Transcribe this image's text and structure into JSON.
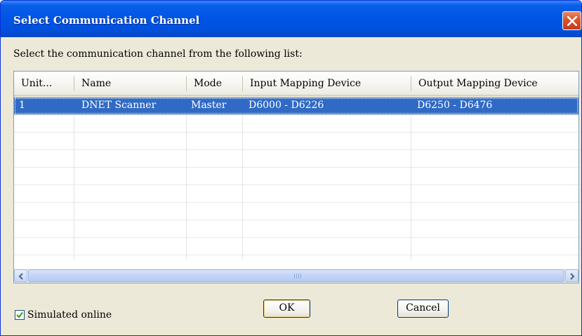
{
  "window": {
    "title": "Select Communication Channel",
    "close_icon": "close-x-icon"
  },
  "prompt": "Select the communication channel from the following list:",
  "table": {
    "columns": [
      "Unit...",
      "Name",
      "Mode",
      "Input Mapping Device",
      "Output Mapping Device"
    ],
    "rows": [
      {
        "unit": "1",
        "name": "DNET Scanner",
        "mode": "Master",
        "input": "D6000 - D6226",
        "output": "D6250 - D6476",
        "selected": true
      }
    ],
    "selection_color": "#316ac5"
  },
  "scrollbar": {
    "left_icon": "arrow-left-icon",
    "right_icon": "arrow-right-icon"
  },
  "simulated_online": {
    "label": "Simulated online",
    "checked": true
  },
  "buttons": {
    "ok_label": "OK",
    "cancel_label": "Cancel"
  }
}
